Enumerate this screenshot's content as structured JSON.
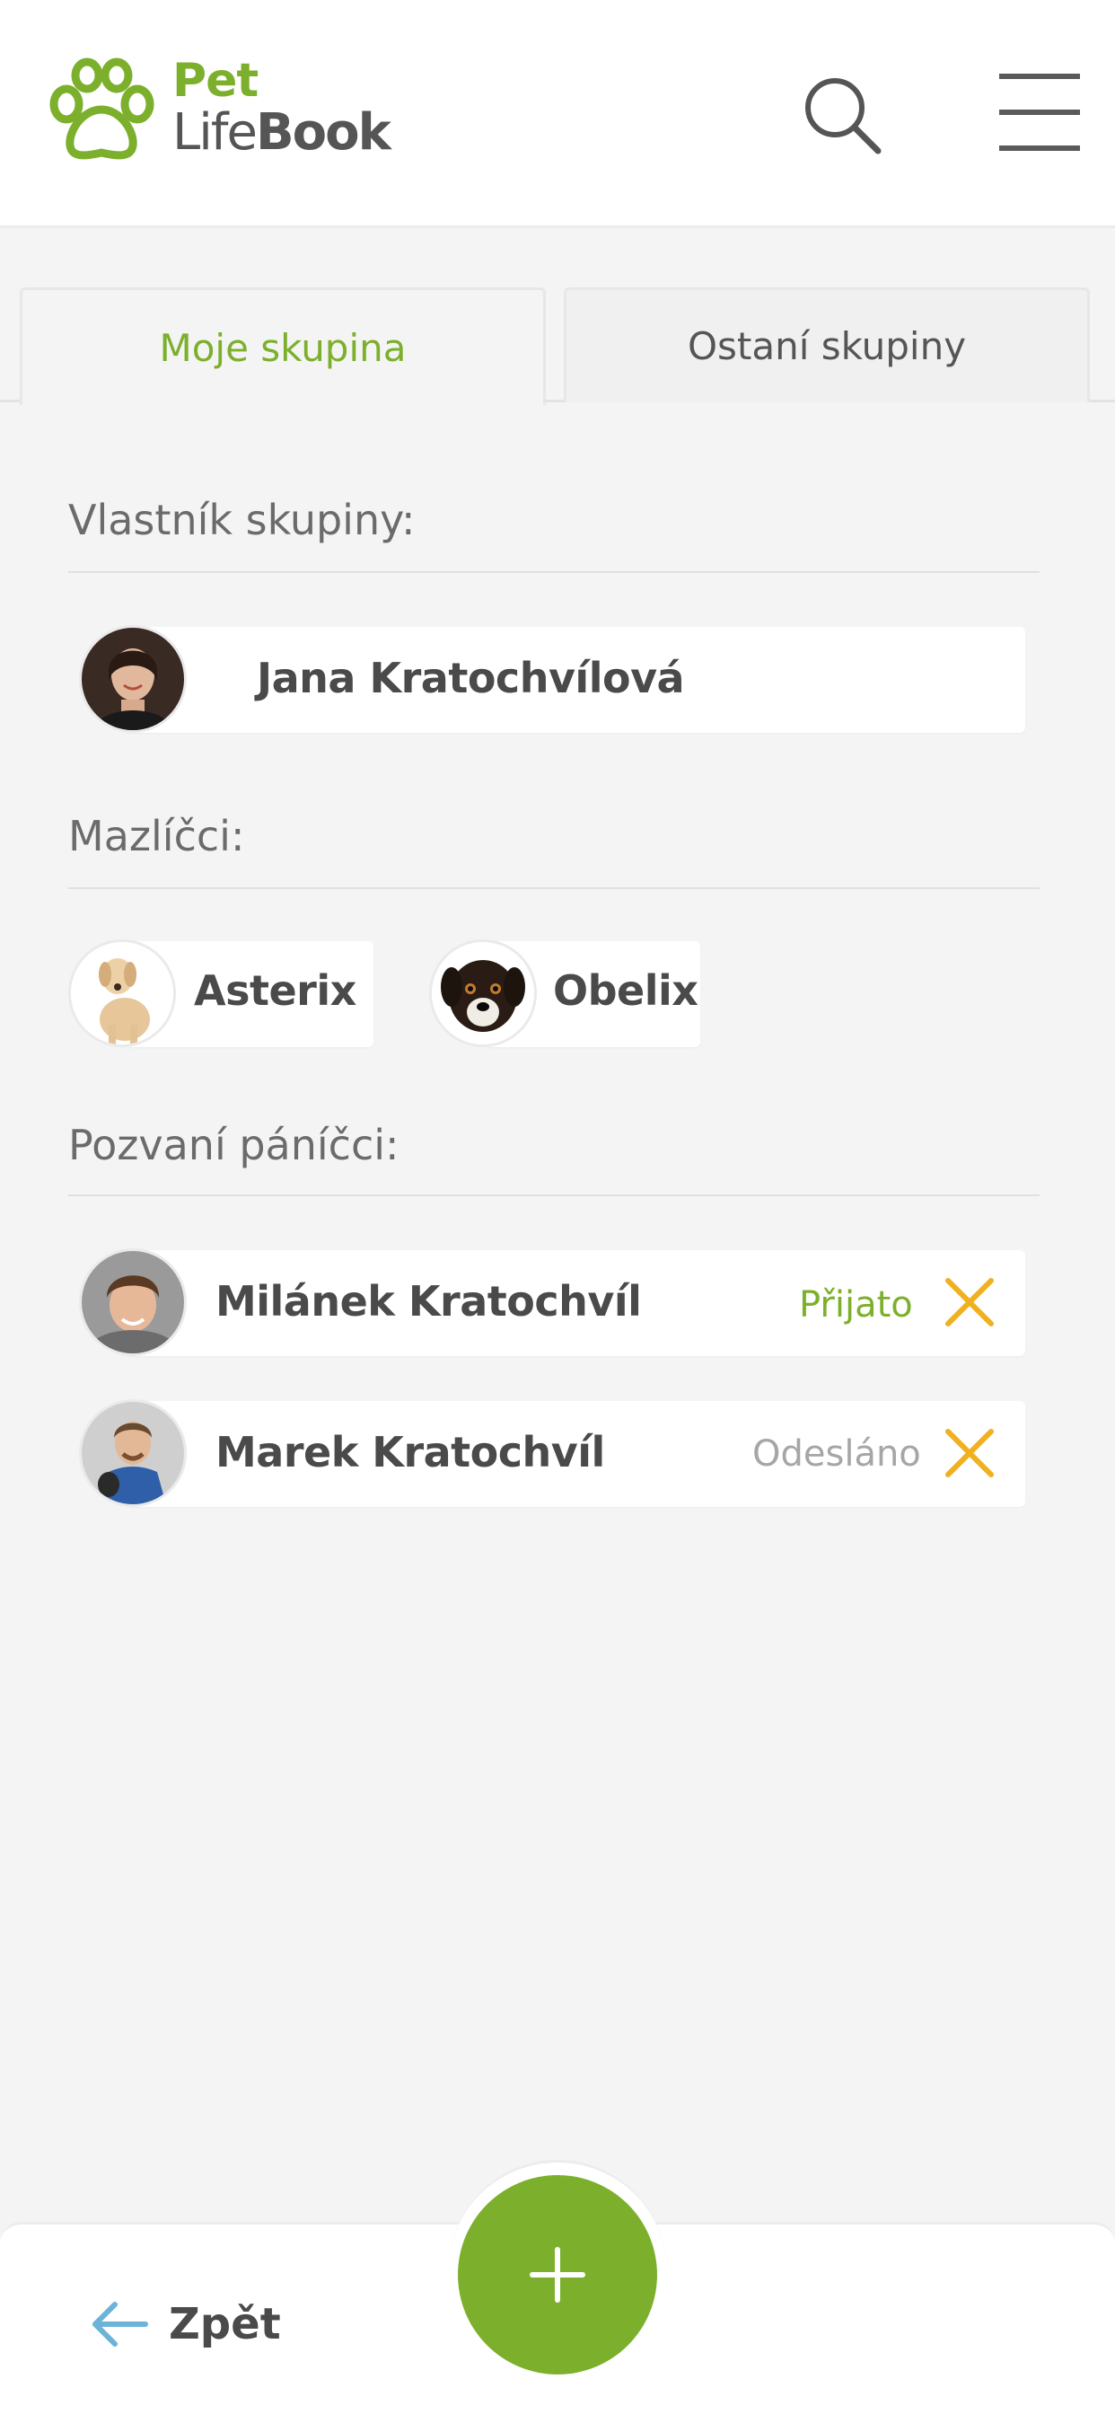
{
  "header": {
    "logo_pet": "Pet",
    "logo_life": "Life",
    "logo_book": "Book",
    "brand_color": "#7cb02c"
  },
  "tabs": [
    {
      "label": "Moje skupina",
      "active": true
    },
    {
      "label": "Ostaní skupiny",
      "active": false
    }
  ],
  "owner": {
    "section_label": "Vlastník skupiny:",
    "name": "Jana Kratochvílová"
  },
  "pets": {
    "section_label": "Mazlíčci:",
    "items": [
      {
        "name": "Asterix"
      },
      {
        "name": "Obelix"
      }
    ]
  },
  "invited": {
    "section_label": "Pozvaní páníčci:",
    "items": [
      {
        "name": "Milánek Kratochvíl",
        "status": "Přijato",
        "status_color": "#7cb02c"
      },
      {
        "name": "Marek Kratochvíl",
        "status": "Odesláno",
        "status_color": "#a6a6a6"
      }
    ]
  },
  "footer": {
    "back_label": "Zpět",
    "add_icon": "plus-icon",
    "remove_color": "#f0b020"
  }
}
